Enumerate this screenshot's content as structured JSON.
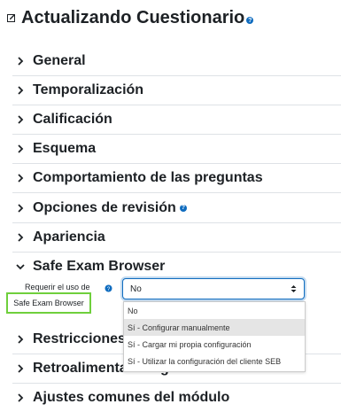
{
  "header": {
    "title": "Actualizando Cuestionario",
    "help_icon": "question-circle-icon"
  },
  "sections": [
    {
      "label": "General"
    },
    {
      "label": "Temporalización"
    },
    {
      "label": "Calificación"
    },
    {
      "label": "Esquema"
    },
    {
      "label": "Comportamiento de las preguntas"
    },
    {
      "label": "Opciones de revisión"
    },
    {
      "label": "Apariencia"
    },
    {
      "label": "Safe Exam Browser"
    },
    {
      "label": "Restricciones extra sobre los intentos"
    },
    {
      "label": "Retroalimentación global"
    },
    {
      "label": "Ajustes comunes del módulo"
    }
  ],
  "seb": {
    "field_label": "Requerir el uso de",
    "select_value": "No",
    "options": [
      "No",
      "Sí - Configurar manualmente",
      "Sí - Cargar mi propia configuración",
      "Sí - Utilizar la configuración del cliente SEB"
    ],
    "tooltip": "Safe Exam Browser"
  },
  "colors": {
    "accent": "#0f6cbf",
    "tooltip_border": "#6fcf3c",
    "highlight": "#e5e5e5"
  }
}
